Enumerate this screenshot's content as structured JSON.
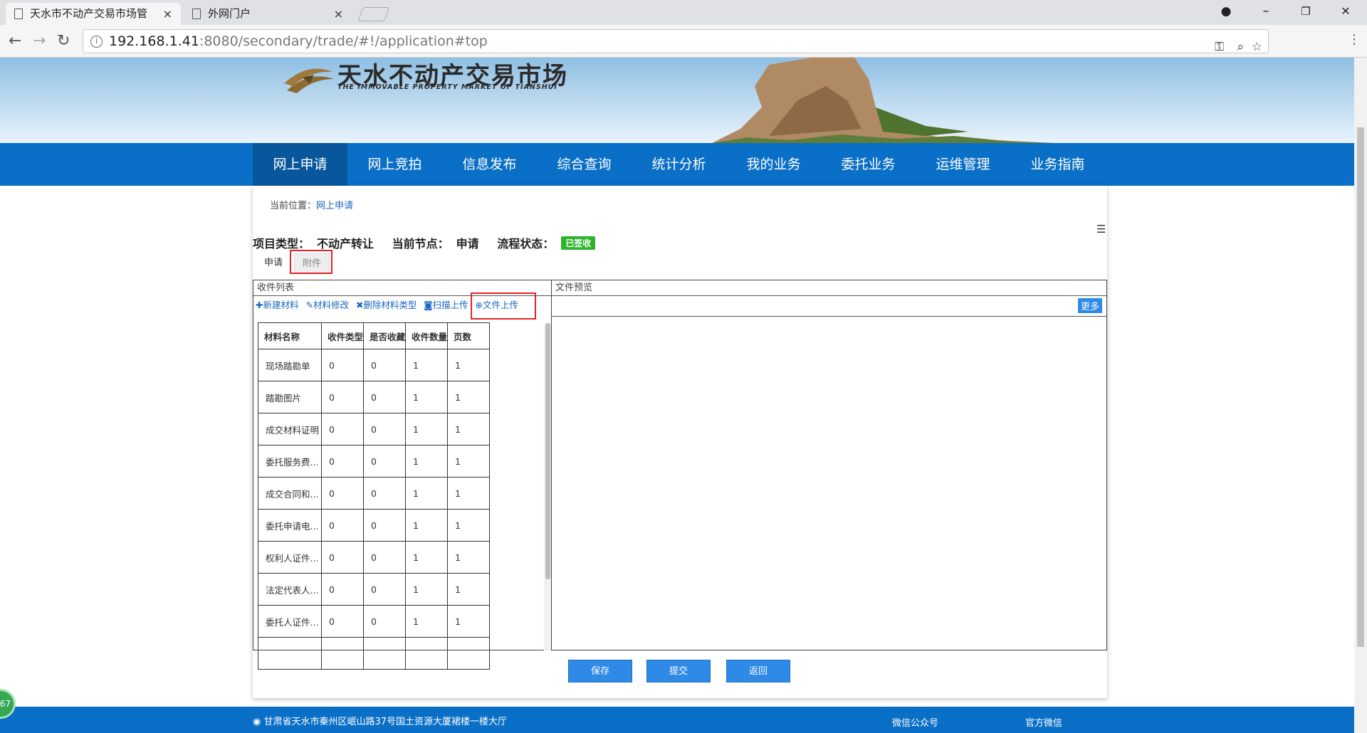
{
  "browser": {
    "tabs": [
      {
        "title": "天水市不动产交易市场管",
        "close": "×"
      },
      {
        "title": "外网门户",
        "close": "×"
      }
    ],
    "url_host": "192.168.1.41",
    "url_path": ":8080/secondary/trade/#!/application#top",
    "window_controls": {
      "minimize": "–",
      "restore": "❐",
      "close": "✕"
    }
  },
  "site": {
    "logo_cn": "天水不动产交易市场",
    "logo_en": "THE IMMOVABLE PROPERTY MARKET OF TIANSHUI",
    "nav": [
      "网上申请",
      "网上竞拍",
      "信息发布",
      "综合查询",
      "统计分析",
      "我的业务",
      "委托业务",
      "运维管理",
      "业务指南"
    ]
  },
  "breadcrumb": {
    "prefix": "当前位置：",
    "current": "网上申请"
  },
  "project": {
    "type_label": "项目类型：",
    "type_value": "不动产转让",
    "node_label": "当前节点：",
    "node_value": "申请",
    "status_label": "流程状态：",
    "status_value": "已签收"
  },
  "page_tabs": {
    "apply": "申请",
    "attach": "附件"
  },
  "left_panel": {
    "title": "收件列表",
    "toolbar": {
      "new": "✚新建材料",
      "edit": "✎材料修改",
      "delete": "✖删除材料类型",
      "scan": "◙扫描上传",
      "upload": "⊕文件上传"
    },
    "columns": [
      "材料名称",
      "收件类型",
      "是否收藏",
      "收件数量",
      "页数"
    ],
    "rows": [
      [
        "现场踏勘单",
        "0",
        "0",
        "1",
        "1"
      ],
      [
        "踏勘图片",
        "0",
        "0",
        "1",
        "1"
      ],
      [
        "成交材料证明",
        "0",
        "0",
        "1",
        "1"
      ],
      [
        "委托服务费...",
        "0",
        "0",
        "1",
        "1"
      ],
      [
        "成交合同和...",
        "0",
        "0",
        "1",
        "1"
      ],
      [
        "委托申请电...",
        "0",
        "0",
        "1",
        "1"
      ],
      [
        "权利人证件...",
        "0",
        "0",
        "1",
        "1"
      ],
      [
        "法定代表人...",
        "0",
        "0",
        "1",
        "1"
      ],
      [
        "委托人证件...",
        "0",
        "0",
        "1",
        "1"
      ],
      [
        "",
        "",
        "",
        "",
        ""
      ]
    ]
  },
  "right_panel": {
    "title": "文件预览",
    "more": "更多"
  },
  "actions": {
    "save": "保存",
    "submit": "提交",
    "back": "返回"
  },
  "footer": {
    "address": "甘肃省天水市秦州区岷山路37号国土资源大厦裙楼一楼大厅",
    "wechat_public": "微信公众号",
    "wechat_official": "官方微信"
  },
  "bubble_number": "67",
  "colors": {
    "nav_blue": "#0a6fc6",
    "nav_active": "#08569c",
    "button_blue": "#2e8ae6",
    "status_green": "#2cb42c",
    "highlight_red": "#e02525"
  }
}
